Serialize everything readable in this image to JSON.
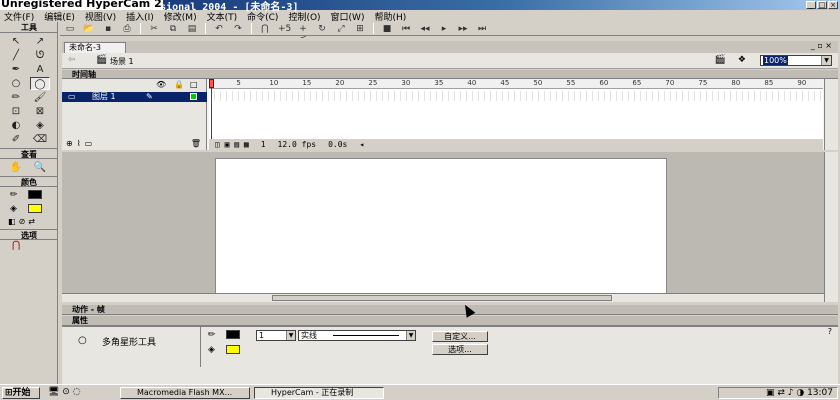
{
  "window": {
    "title": "rofessional 2004 - [未命名-3]",
    "watermark": "Unregistered HyperCam 2",
    "controls": [
      "_",
      "□",
      "×"
    ]
  },
  "menu": [
    "文件(F)",
    "编辑(E)",
    "视图(V)",
    "插入(I)",
    "修改(M)",
    "文本(T)",
    "命令(C)",
    "控制(O)",
    "窗口(W)",
    "帮助(H)"
  ],
  "toolbox": {
    "title": "工具",
    "tools": [
      "selection-arrow",
      "subselect-arrow",
      "line",
      "lasso",
      "pen",
      "text",
      "oval",
      "polystar",
      "pencil",
      "brush",
      "free-transform",
      "fill-transform",
      "ink-bottle",
      "paint-bucket",
      "eyedropper",
      "eraser"
    ],
    "view_title": "查看",
    "view_tools": [
      "hand",
      "zoom"
    ],
    "colors_title": "颜色",
    "options_title": "选项"
  },
  "document": {
    "tab": "未命名-3",
    "scene": "场景 1",
    "zoom": "100%"
  },
  "timeline": {
    "title": "时间轴",
    "layer": "图层 1",
    "ruler": [
      "1",
      "5",
      "10",
      "15",
      "20",
      "25",
      "30",
      "35",
      "40",
      "45",
      "50",
      "55",
      "60",
      "65",
      "70",
      "75",
      "80",
      "85",
      "90"
    ],
    "current_frame": "1",
    "fps": "12.0 fps",
    "time": "0.0s"
  },
  "actions_panel": {
    "title": "动作 - 帧"
  },
  "properties": {
    "title": "属性",
    "tool_name": "多角星形工具",
    "stroke_width": "1",
    "stroke_style": "实线",
    "custom_button": "自定义...",
    "options_button": "选项...",
    "stroke_color": "#000000",
    "fill_color": "#ffff00"
  },
  "taskbar": {
    "start": "开始",
    "tasks": [
      "Macromedia Flash MX...",
      "HyperCam - 正在录制"
    ],
    "clock": "13:07"
  }
}
